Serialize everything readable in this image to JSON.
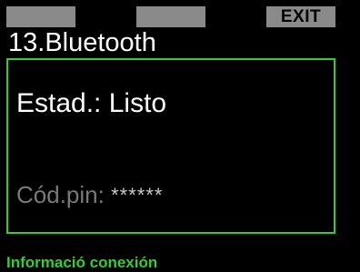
{
  "softkeys": {
    "left_label": "",
    "middle_label": "",
    "right_label": "EXIT"
  },
  "menu": {
    "title": "13.Bluetooth"
  },
  "panel": {
    "status_label": "Estad.:",
    "status_value": "Listo",
    "pin_label": "Cód.pin:",
    "pin_value": "******"
  },
  "footer": {
    "info_text": "Informació conexión"
  },
  "colors": {
    "accent_green": "#2fd02f",
    "softkey_gray": "#8a8a8a",
    "background": "#000000"
  }
}
